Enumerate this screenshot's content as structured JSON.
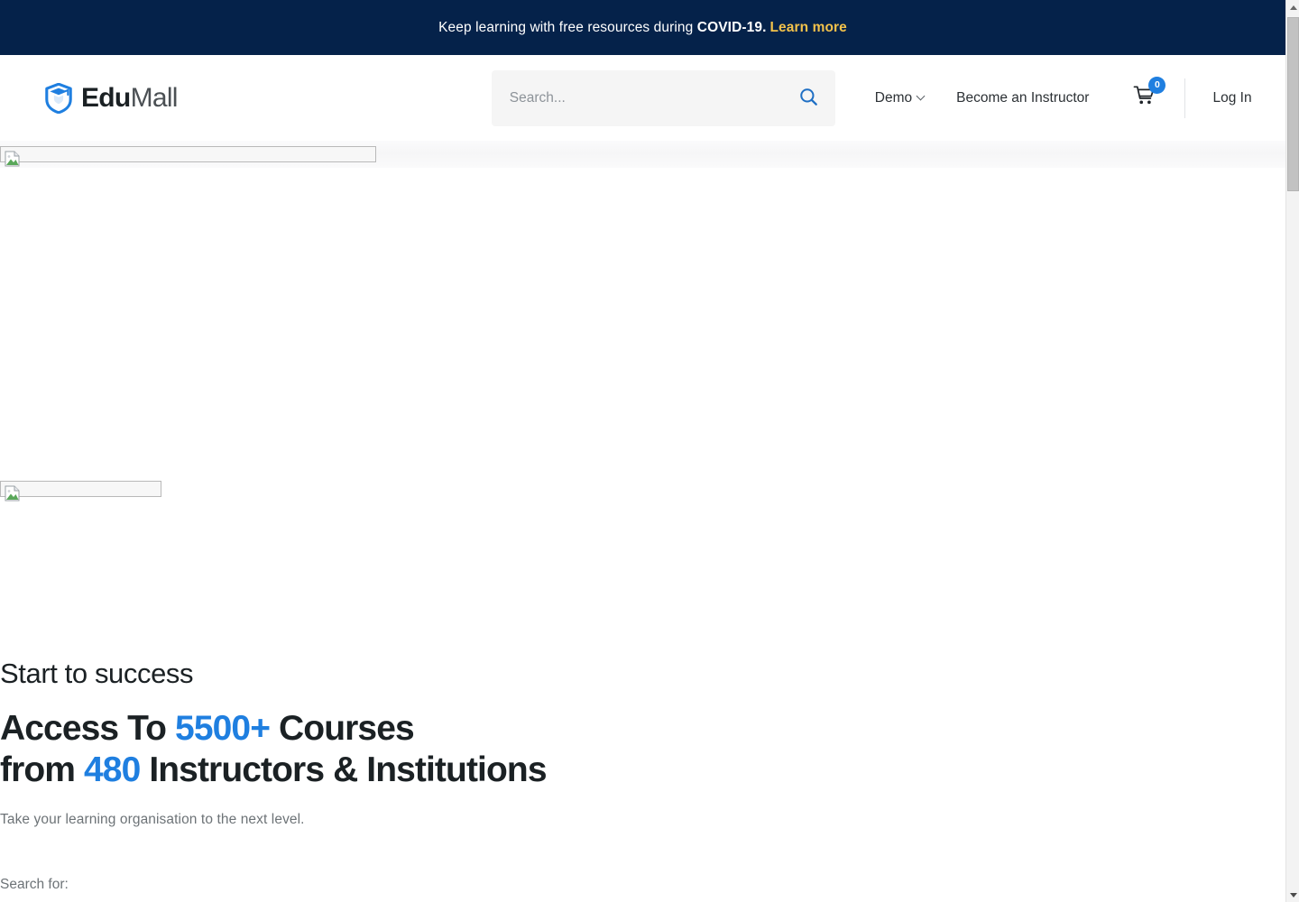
{
  "announcement": {
    "text_before": "Keep learning with free resources during ",
    "strong": "COVID-19.",
    "link_label": "Learn more",
    "bg_color": "#05224a",
    "link_color": "#f3c24b"
  },
  "header": {
    "brand": {
      "edu": "Edu",
      "mall": "Mall",
      "mark_icon": "shield-graduation-cap-icon",
      "mark_color": "#1f7fe0"
    },
    "search": {
      "placeholder": "Search...",
      "value": "",
      "button_icon": "search-icon"
    },
    "nav": [
      {
        "label": "Demo",
        "has_dropdown": true
      },
      {
        "label": "Become an Instructor",
        "has_dropdown": false
      }
    ],
    "cart": {
      "icon": "shopping-cart-icon",
      "count": "0",
      "badge_color": "#1f7fe0"
    },
    "login_label": "Log In"
  },
  "hero": {
    "background_image": {
      "icon": "broken-image-icon",
      "alt": ""
    },
    "shape_image": {
      "icon": "broken-image-icon",
      "alt": ""
    },
    "eyebrow": "Start to success",
    "title_line1_a": "Access To ",
    "title_line1_accent": "5500+",
    "title_line1_b": " Courses",
    "title_line2_a": "from ",
    "title_line2_accent": "480",
    "title_line2_b": " Instructors & Institutions",
    "subtitle": "Take your learning organisation to the next level.",
    "search_for_label": "Search for:",
    "accent_color": "#1f7fe0"
  },
  "scrollbar": {
    "up_arrow_icon": "chevron-up-icon",
    "down_arrow_icon": "chevron-down-icon",
    "orientation": "vertical"
  }
}
